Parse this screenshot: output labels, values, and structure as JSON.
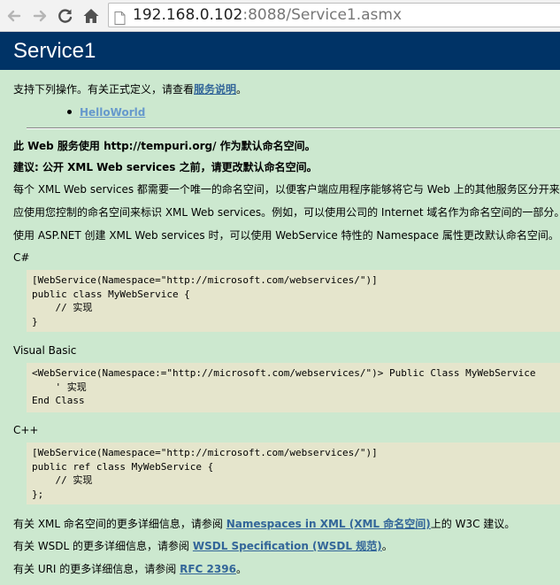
{
  "browser": {
    "url_host": "192.168.0.102",
    "url_rest": ":8088/Service1.asmx"
  },
  "page": {
    "title": "Service1",
    "intro_prefix": "支持下列操作。有关正式定义，请查看",
    "intro_link": "服务说明",
    "intro_suffix": "。",
    "operations": [
      "HelloWorld"
    ],
    "ns_notice_1": "此 Web 服务使用 http://tempuri.org/ 作为默认命名空间。",
    "ns_notice_2": "建议: 公开 XML Web services 之前，请更改默认命名空间。",
    "para_1": "每个 XML Web services 都需要一个唯一的命名空间，以便客户端应用程序能够将它与 Web 上的其他服务区分开来。",
    "para_2": "应使用您控制的命名空间来标识 XML Web services。例如，可以使用公司的 Internet 域名作为命名空间的一部分。",
    "para_3": "使用 ASP.NET 创建 XML Web services 时，可以使用 WebService 特性的 Namespace 属性更改默认命名空间。",
    "lang_cs": "C#",
    "code_cs": "[WebService(Namespace=\"http://microsoft.com/webservices/\")]\npublic class MyWebService {\n    // 实现\n}",
    "lang_vb": "Visual Basic",
    "code_vb": "<WebService(Namespace:=\"http://microsoft.com/webservices/\")> Public Class MyWebService\n    ' 实现\nEnd Class",
    "lang_cpp": "C++",
    "code_cpp": "[WebService(Namespace=\"http://microsoft.com/webservices/\")]\npublic ref class MyWebService {\n    // 实现\n};",
    "more_xml_prefix": "有关 XML 命名空间的更多详细信息，请参阅 ",
    "more_xml_link": "Namespaces in XML (XML 命名空间)",
    "more_xml_suffix": "上的 W3C 建议。",
    "more_wsdl_prefix": "有关 WSDL 的更多详细信息，请参阅 ",
    "more_wsdl_link": "WSDL Specification (WSDL 规范)",
    "more_wsdl_suffix": "。",
    "more_uri_prefix": "有关 URI 的更多详细信息，请参阅 ",
    "more_uri_link": "RFC 2396",
    "more_uri_suffix": "。"
  },
  "colors": {
    "page_bg": "#cce8cf",
    "heading_bg": "#003366",
    "link": "#336699",
    "code_bg": "#e5e5cc"
  }
}
